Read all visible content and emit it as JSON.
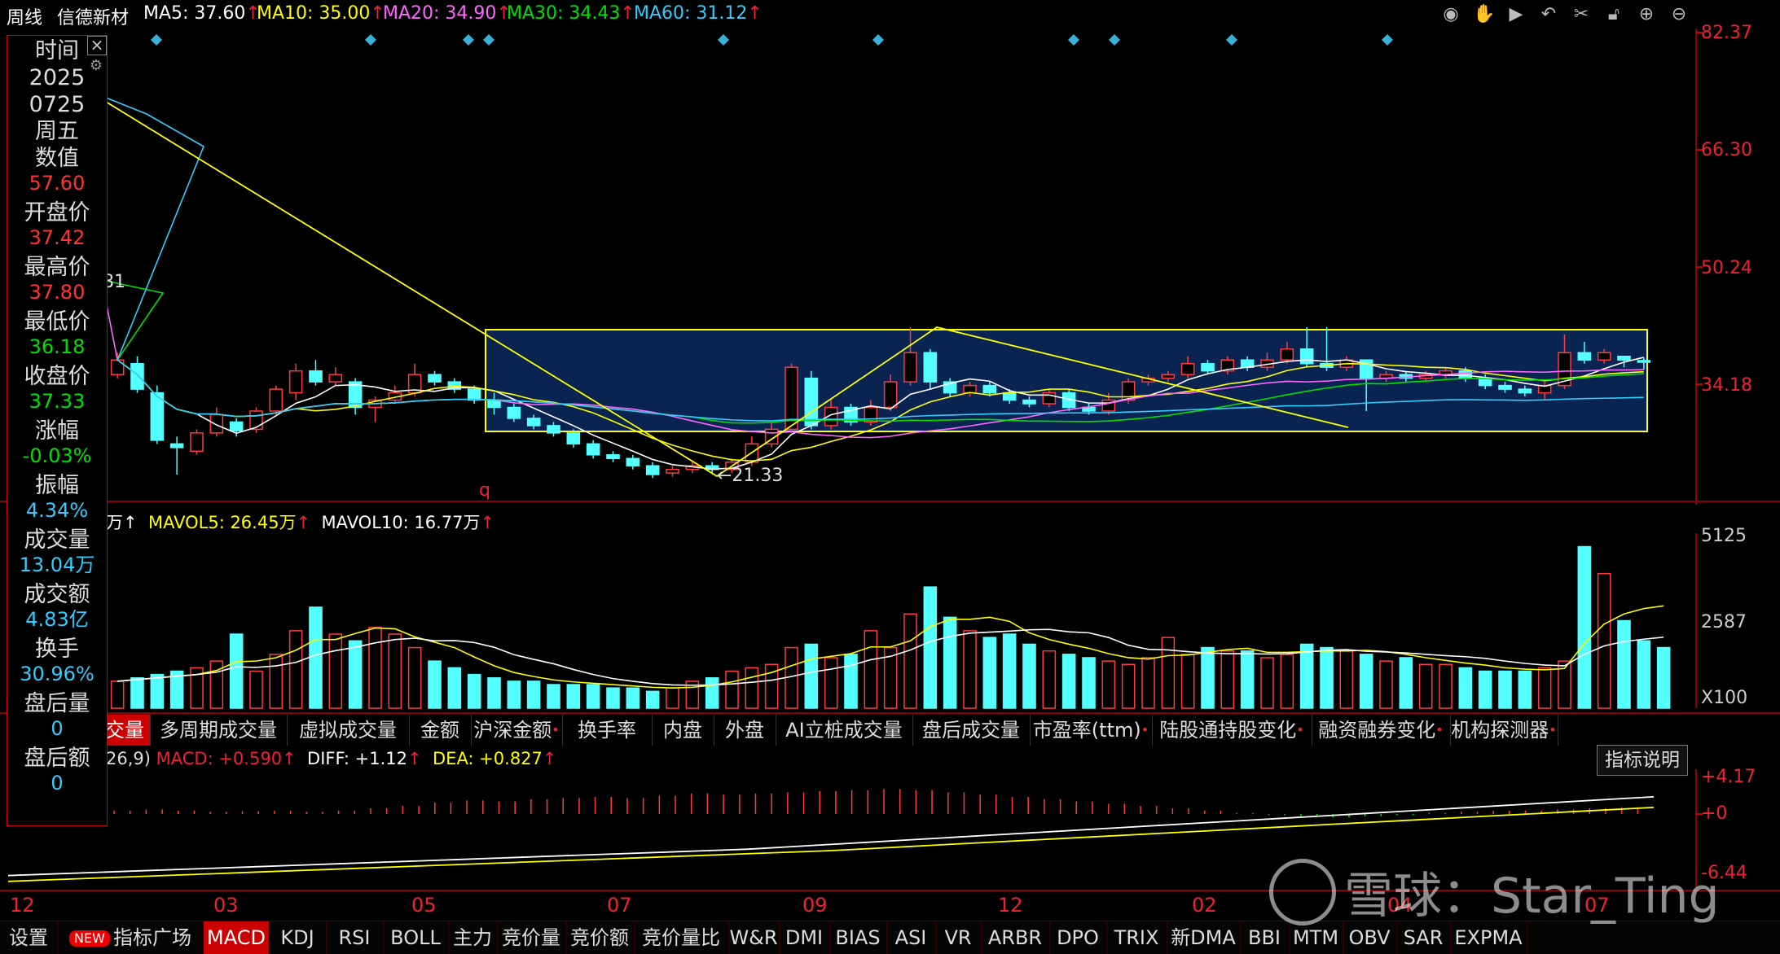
{
  "topbar": {
    "period": "周线",
    "stock_name": "信德新材",
    "ma": [
      {
        "label": "MA5: 37.60",
        "arrow": "↑",
        "color": "#ffffff"
      },
      {
        "label": "MA10: 35.00",
        "arrow": "↑",
        "color": "#ffff00"
      },
      {
        "label": "MA20: 34.90",
        "arrow": "↑",
        "color": "#ff66ff"
      },
      {
        "label": "MA30: 34.43",
        "arrow": "↑",
        "color": "#00e000"
      },
      {
        "label": "MA60: 31.12",
        "arrow": "↑",
        "color": "#33ccff"
      }
    ],
    "icons": [
      "eye-icon",
      "hand-icon",
      "play-icon",
      "undo-icon",
      "scissors-icon",
      "lock-icon",
      "zoom-in-icon",
      "zoom-out-icon"
    ]
  },
  "side_panel": {
    "close": "×",
    "settings": "⚙",
    "rows": [
      {
        "label": "时间",
        "value": null
      },
      {
        "label": "2025",
        "value": null
      },
      {
        "label": "0725",
        "value": null
      },
      {
        "label": "周五",
        "value": null
      },
      {
        "label": "数值",
        "value": "57.60",
        "color": "#ff3333"
      },
      {
        "label": "开盘价",
        "value": "37.42",
        "color": "#ff3333"
      },
      {
        "label": "最高价",
        "value": "37.80",
        "color": "#ff3333"
      },
      {
        "label": "最低价",
        "value": "36.18",
        "color": "#00e000"
      },
      {
        "label": "收盘价",
        "value": "37.33",
        "color": "#00e000"
      },
      {
        "label": "涨幅",
        "value": "-0.03%",
        "color": "#00e000"
      },
      {
        "label": "振幅",
        "value": "4.34%",
        "color": "#33ccff"
      },
      {
        "label": "成交量",
        "value": "13.04万",
        "color": "#33ccff"
      },
      {
        "label": "成交额",
        "value": "4.83亿",
        "color": "#33ccff"
      },
      {
        "label": "换手",
        "value": "30.96%",
        "color": "#33ccff"
      },
      {
        "label": "盘后量",
        "value": "0",
        "color": "#33ccff"
      },
      {
        "label": "盘后额",
        "value": "0",
        "color": "#33ccff"
      }
    ]
  },
  "price_axis": [
    "82.37",
    "66.30",
    "50.24",
    "34.18"
  ],
  "price_annotations": {
    "high_left": "81",
    "low": "←21.33",
    "marker_q": "q"
  },
  "volume_info": {
    "unit_prefix": "万↑",
    "mavol5": "MAVOL5: 26.45万",
    "mavol10": "MAVOL10: 16.77万",
    "arrow": "↑"
  },
  "volume_axis": [
    "5125",
    "2587",
    "X100"
  ],
  "indicator_tabs": [
    {
      "label": "交量",
      "active": true,
      "dot": false
    },
    {
      "label": "多周期成交量",
      "active": false,
      "dot": false
    },
    {
      "label": "虚拟成交量",
      "active": false,
      "dot": false
    },
    {
      "label": "金额",
      "active": false,
      "dot": false
    },
    {
      "label": "沪深金额",
      "active": false,
      "dot": true
    },
    {
      "label": "换手率",
      "active": false,
      "dot": false
    },
    {
      "label": "内盘",
      "active": false,
      "dot": false
    },
    {
      "label": "外盘",
      "active": false,
      "dot": false
    },
    {
      "label": "AI立桩成交量",
      "active": false,
      "dot": false
    },
    {
      "label": "盘后成交量",
      "active": false,
      "dot": false
    },
    {
      "label": "市盈率(ttm)",
      "active": false,
      "dot": true
    },
    {
      "label": "陆股通持股变化",
      "active": false,
      "dot": true
    },
    {
      "label": "融资融券变化",
      "active": false,
      "dot": true
    },
    {
      "label": "机构探测器",
      "active": false,
      "dot": true
    }
  ],
  "macd_info": {
    "params": "26,9)",
    "macd": "MACD: +0.590",
    "diff": "DIFF: +1.12",
    "dea": "DEA: +0.827",
    "arrow": "↑"
  },
  "macd_axis": [
    "+4.17",
    "+0",
    "-6.44"
  ],
  "explain_button": "指标说明",
  "x_axis": [
    "12",
    "03",
    "05",
    "07",
    "09",
    "12",
    "02",
    "04",
    "07"
  ],
  "bottom_tabs": [
    {
      "label": "设置",
      "active": false,
      "badge": null
    },
    {
      "label": "指标广场",
      "active": false,
      "badge": "NEW"
    },
    {
      "label": "MACD",
      "active": true,
      "badge": null
    },
    {
      "label": "KDJ",
      "active": false,
      "badge": null
    },
    {
      "label": "RSI",
      "active": false,
      "badge": null
    },
    {
      "label": "BOLL",
      "active": false,
      "badge": null
    },
    {
      "label": "主力",
      "active": false,
      "badge": null
    },
    {
      "label": "竞价量",
      "active": false,
      "badge": null
    },
    {
      "label": "竞价额",
      "active": false,
      "badge": null
    },
    {
      "label": "竞价量比",
      "active": false,
      "badge": null
    },
    {
      "label": "W&R",
      "active": false,
      "badge": null
    },
    {
      "label": "DMI",
      "active": false,
      "badge": null
    },
    {
      "label": "BIAS",
      "active": false,
      "badge": null
    },
    {
      "label": "ASI",
      "active": false,
      "badge": null
    },
    {
      "label": "VR",
      "active": false,
      "badge": null
    },
    {
      "label": "ARBR",
      "active": false,
      "badge": null
    },
    {
      "label": "DPO",
      "active": false,
      "badge": null
    },
    {
      "label": "TRIX",
      "active": false,
      "badge": null
    },
    {
      "label": "新DMA",
      "active": false,
      "badge": null
    },
    {
      "label": "BBI",
      "active": false,
      "badge": null
    },
    {
      "label": "MTM",
      "active": false,
      "badge": null
    },
    {
      "label": "OBV",
      "active": false,
      "badge": null
    },
    {
      "label": "SAR",
      "active": false,
      "badge": null
    },
    {
      "label": "EXPMA",
      "active": false,
      "badge": null
    }
  ],
  "watermark": "雪球：Star_Ting",
  "chart_data": {
    "type": "candlestick",
    "price_range": [
      15,
      82.37
    ],
    "candles": [
      [
        35.5,
        37.5,
        38.5,
        35
      ],
      [
        37,
        33.5,
        38,
        33
      ],
      [
        33,
        26.5,
        34,
        26
      ],
      [
        26,
        25.5,
        27,
        21.8
      ],
      [
        25,
        27.5,
        28,
        24.5
      ],
      [
        27.5,
        30,
        31,
        27
      ],
      [
        29,
        27.8,
        29.5,
        27
      ],
      [
        28,
        30.5,
        31,
        27.5
      ],
      [
        30.5,
        33.5,
        34,
        30
      ],
      [
        33,
        36,
        37,
        32
      ],
      [
        36,
        34.5,
        37.5,
        34
      ],
      [
        34.5,
        35.5,
        36.5,
        34
      ],
      [
        34.5,
        31,
        35,
        30
      ],
      [
        31,
        32,
        32.5,
        29
      ],
      [
        32,
        33,
        34,
        31.5
      ],
      [
        33,
        35.5,
        37,
        32.5
      ],
      [
        35.5,
        34.5,
        36,
        34
      ],
      [
        34.5,
        33.5,
        35,
        33
      ],
      [
        33.5,
        32,
        34,
        31.5
      ],
      [
        32,
        31,
        33,
        30
      ],
      [
        31,
        29.5,
        31.5,
        29
      ],
      [
        29.5,
        28.5,
        30,
        28
      ],
      [
        28.5,
        27.5,
        29,
        27
      ],
      [
        27.5,
        26,
        28,
        25.5
      ],
      [
        26,
        24.5,
        26.5,
        24
      ],
      [
        24.5,
        24,
        25,
        23.5
      ],
      [
        24,
        23,
        24.5,
        22.5
      ],
      [
        23,
        21.8,
        23.5,
        21.33
      ],
      [
        22,
        22.5,
        23,
        21.5
      ],
      [
        22.5,
        23,
        23.5,
        22
      ],
      [
        23,
        22.5,
        23.5,
        22
      ],
      [
        22.5,
        23.5,
        24,
        22
      ],
      [
        23.5,
        26,
        27,
        23
      ],
      [
        26,
        28,
        29,
        25.5
      ],
      [
        28,
        36.5,
        37,
        27.5
      ],
      [
        35,
        28.5,
        36,
        28
      ],
      [
        28.5,
        31,
        32,
        28
      ],
      [
        31,
        29,
        31.5,
        28.5
      ],
      [
        29,
        31,
        32,
        28.5
      ],
      [
        31,
        34.5,
        35.5,
        30.5
      ],
      [
        34.5,
        38.5,
        42,
        34
      ],
      [
        38.5,
        34.5,
        39,
        33.5
      ],
      [
        34.5,
        33,
        35,
        32.5
      ],
      [
        33,
        34,
        34.5,
        32.5
      ],
      [
        34,
        33,
        34.5,
        32.5
      ],
      [
        33,
        32,
        33.5,
        31.5
      ],
      [
        32,
        31.5,
        32.5,
        31
      ],
      [
        31.5,
        33,
        33.5,
        31
      ],
      [
        33,
        31,
        33.5,
        30.5
      ],
      [
        31,
        30.5,
        31.5,
        30
      ],
      [
        30.5,
        32,
        33,
        30
      ],
      [
        32,
        34.5,
        35,
        31.5
      ],
      [
        34.5,
        35,
        35.5,
        34
      ],
      [
        35,
        35.5,
        36,
        34.5
      ],
      [
        35.5,
        37,
        38,
        35
      ],
      [
        37,
        36,
        37.5,
        35.5
      ],
      [
        36,
        37.5,
        38,
        35.5
      ],
      [
        37.5,
        36.5,
        38,
        36
      ],
      [
        36.5,
        37.5,
        38.5,
        36
      ],
      [
        37.5,
        39,
        40,
        37
      ],
      [
        39,
        37,
        42,
        36.5
      ],
      [
        37,
        36.5,
        42,
        36
      ],
      [
        36.5,
        37.5,
        38,
        36
      ],
      [
        37.5,
        35,
        37.5,
        30.5
      ],
      [
        35,
        35.5,
        36,
        34.5
      ],
      [
        35.5,
        35,
        36,
        34.5
      ],
      [
        35,
        35.5,
        36,
        34.5
      ],
      [
        35.5,
        36,
        36.5,
        35
      ],
      [
        36,
        35,
        36.5,
        34.5
      ],
      [
        35,
        34,
        35.5,
        33.5
      ],
      [
        34,
        33.5,
        34.5,
        33
      ],
      [
        33.5,
        33,
        34,
        32.5
      ],
      [
        33,
        34,
        34.5,
        32
      ],
      [
        34,
        38.5,
        41,
        33.5
      ],
      [
        38.5,
        37.5,
        40,
        37
      ],
      [
        37.5,
        38.5,
        39,
        37
      ],
      [
        38,
        37.5,
        38,
        36.5
      ],
      [
        37.42,
        37.33,
        37.8,
        36.18
      ]
    ],
    "volumes": [
      8,
      9,
      10,
      11,
      12,
      14,
      22,
      11,
      16,
      23,
      30,
      22,
      20,
      24,
      22,
      18,
      14,
      12,
      10,
      9,
      8,
      8,
      7,
      7,
      7,
      6,
      6,
      5,
      6,
      8,
      9,
      11,
      12,
      13,
      18,
      19,
      15,
      16,
      23,
      18,
      28,
      36,
      27,
      23,
      21,
      22,
      19,
      17,
      16,
      15,
      14,
      13,
      15,
      21,
      16,
      18,
      17,
      17,
      15,
      16,
      19,
      18,
      17,
      16,
      14,
      15,
      13,
      13,
      12,
      11,
      11,
      11,
      12,
      14,
      48,
      40,
      26,
      20,
      18
    ],
    "macd_hist": [
      0.3,
      0.4,
      0.3,
      0.2,
      0.25,
      0.3,
      0.2,
      0.3,
      0.5,
      0.7,
      1,
      1.2,
      1.1,
      1.3,
      1.4,
      1.5,
      1.4,
      1.6,
      1.8,
      1.7,
      1.8,
      1.9,
      2,
      2.1,
      2.2,
      2.1,
      1.9,
      1.7,
      1.5,
      1.3,
      1.1,
      0.9,
      0.7,
      0.5,
      0.3,
      0.1,
      -0.1,
      -0.2,
      -0.3,
      -0.2,
      -0.1,
      0.1,
      0.2,
      0.3,
      0.3,
      0.4,
      0.5,
      0.59
    ]
  }
}
